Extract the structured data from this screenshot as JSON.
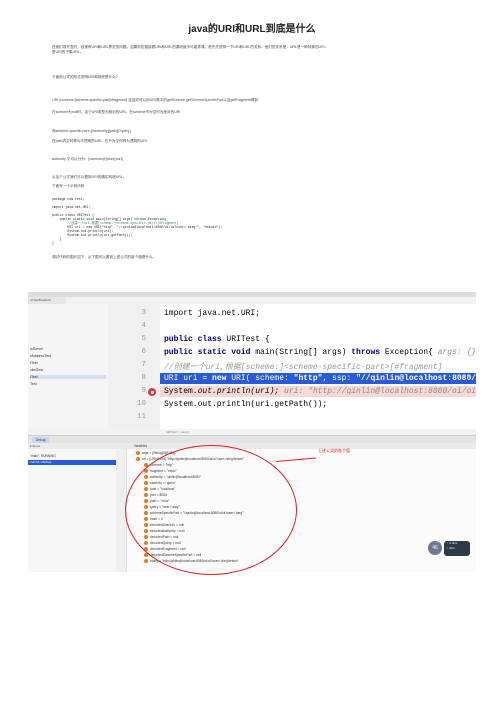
{
  "title": "java的URI和URL到底是什么",
  "intro_lines": [
    "在我们项开发时，经常有URI和URL界定的问题。如果你的直接看URI和URL的源码就不可能弄清。首先先说明一下URI和URL的关系：他们的关系是：URL是一种特殊的URI,",
    "是URI的子集URL。"
  ],
  "para2": "下面用公式的形式说明URI和到底是什么?",
  "para3": "URI=[scheme:]scheme-specific-part[#fragment]   这这好可以用URI类中的getScheme   getSchemeSpecificPart以及getFragment得到.",
  "para4": "在scheme为null时，这个URI类型为相对的URI。在scheme不为空时为绝对的URI",
  "para5": "而scheme-specific-part=[//authority][path][?query]",
  "para6": "在path内空时称为不透明的URI。在不为空时称为透明的URI",
  "para7": "authority 又可以分为：[userinfo@]host[:port]",
  "para8": "从这个公式我们可以看到URI的确实构造URL。",
  "para9": "下面写一个示例代码",
  "code_lines": [
    "package com.test;",
    "",
    "import java.net.URI;",
    "",
    "public class URITest {",
    "    public static void main(String[] args) throws Exception{",
    "        //创建一个uri,根据[scheme:]<scheme-specific-part>[#fragment]",
    "        URI uri = new URI(\"http\", \"//qinlin@localhost:8080/oi/oi?user='aieg'\", \"#eiwio\");",
    "        System.out.println(uri);",
    "        System.out.println(uri.getPath());",
    "    }",
    "}"
  ],
  "para10": "调试代码的图片如下，从下图可以看到上述公式的各个值是什么。",
  "ide": {
    "left_tab": "uriTestBreakvrk",
    "left_items": [
      "ioServer",
      "rAddressTest",
      "tTest",
      "cketTest",
      "ITest",
      "Test"
    ],
    "line_numbers": [
      "3",
      "4",
      "5",
      "6",
      "7",
      "8",
      "9",
      "10",
      "11"
    ],
    "editor_lines": {
      "l3": "import java.net.URI;",
      "l5_kw": "public class",
      "l5_rest": " URITest {",
      "l6_kw": "    public static void",
      "l6_rest": " main(String[] args) ",
      "l6_kw2": "throws",
      "l6_rest2": " Exception{  ",
      "l6_hint": "args: {}",
      "l7": "        //创建一个uri,根据[scheme:]<scheme-specific-part>[#fragment]",
      "l8_pre": "        URI uri = ",
      "l8_kw": "new",
      "l8_mid": " URI( scheme: ",
      "l8_s1": "\"http\"",
      "l8_mid2": ",  ssp: ",
      "l8_s2": "\"//qinlin@localhost:8080/oi/oi?user='aieg'\"",
      "l8_end": ",",
      "l9_pre": "        System.",
      "l9_rest": "out.println(uri);   ",
      "l9_hint": "uri: \"http://qinlin@localhost:8080/oi/oi?user='aieg'#eiwio\"",
      "l10": "        System.out.println(uri.getPath());"
    },
    "breadcrumb": "URITest > main()",
    "debug_tab": "Debug",
    "frames_head": "Frames",
    "thread": "\"main\": RUNNING",
    "frame_sel": "main:8, URITest",
    "vars_head": "Variables",
    "variables": [
      "args = {String[0]@458}",
      "uri = {URI@459} \"http://qinlin@localhost:8080/oi/oi?user='aieg'#eiwio\"",
      "scheme = \"http\"",
      "fragment = \"eiwio\"",
      "authority = \"qinlin@localhost:8080\"",
      "userInfo = \"qinlin\"",
      "host = \"localhost\"",
      "port = 8080",
      "path = \"/oi/oi\"",
      "query = \"user='aieg'\"",
      "schemeSpecificPart = \"//qinlin@localhost:8080/oi/oi?user='aieg'\"",
      "hash = 0",
      "decodedUserInfo = null",
      "decodedAuthority = null",
      "decodedPath = null",
      "decodedQuery = null",
      "decodedFragment = null",
      "decodedSchemeSpecificPart = null",
      "string = \"http://qinlin@localhost:8080/oi/oi?user='aieg'#eiwio\""
    ],
    "annotation": "上述公式的各个值",
    "badge": "46",
    "speed_up": "↑ 0.3k/s",
    "speed_down": "↓ 0k/s"
  }
}
